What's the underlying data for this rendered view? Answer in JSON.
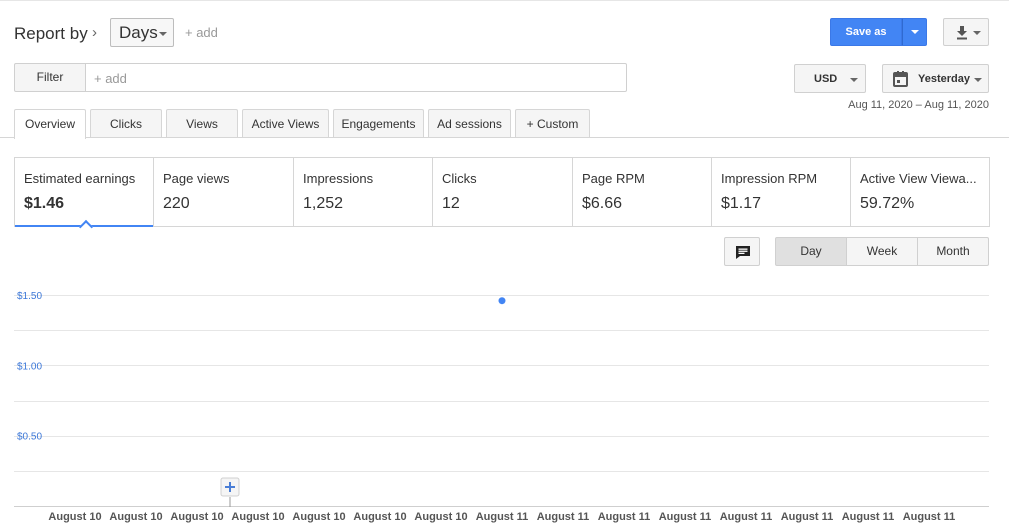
{
  "header": {
    "report_by_label": "Report by",
    "chevron": "›",
    "dimension_value": "Days",
    "add_label": "+ add",
    "save_as_label": "Save as"
  },
  "filter": {
    "button_label": "Filter",
    "placeholder": "+ add"
  },
  "currency": {
    "value": "USD"
  },
  "date": {
    "value": "Yesterday",
    "range": "Aug 11, 2020 – Aug 11, 2020"
  },
  "tabs": [
    {
      "label": "Overview",
      "active": true
    },
    {
      "label": "Clicks"
    },
    {
      "label": "Views"
    },
    {
      "label": "Active Views"
    },
    {
      "label": "Engagements"
    },
    {
      "label": "Ad sessions"
    },
    {
      "label": "+  Custom"
    }
  ],
  "metrics": [
    {
      "label": "Estimated earnings",
      "value": "$1.46",
      "selected": true
    },
    {
      "label": "Page views",
      "value": "220"
    },
    {
      "label": "Impressions",
      "value": "1,252"
    },
    {
      "label": "Clicks",
      "value": "12"
    },
    {
      "label": "Page RPM",
      "value": "$6.66"
    },
    {
      "label": "Impression RPM",
      "value": "$1.17"
    },
    {
      "label": "Active View Viewa...",
      "value": "59.72%"
    }
  ],
  "period": {
    "options": [
      "Day",
      "Week",
      "Month"
    ],
    "selected": "Day"
  },
  "icons": {
    "download": "download-icon",
    "calendar": "calendar-icon",
    "annotate": "comment-icon",
    "add_annotation": "plus-icon"
  },
  "colors": {
    "accent": "#4285f4",
    "axis_label": "#3d78d8",
    "grid": "#e6e6e6"
  },
  "chart_data": {
    "type": "scatter",
    "series": [
      {
        "values": [
          1.46
        ]
      }
    ],
    "x_ticks": [
      "August 10",
      "August 10",
      "August 10",
      "August 10",
      "August 10",
      "August 10",
      "August 10",
      "August 11",
      "August 11",
      "August 11",
      "August 11",
      "August 11",
      "August 11",
      "August 11",
      "August 11"
    ],
    "y_ticks": [
      "$1.50",
      "$1.00",
      "$0.50"
    ],
    "point_x_index": 7,
    "ylim": [
      0,
      1.625
    ],
    "grid": true
  }
}
